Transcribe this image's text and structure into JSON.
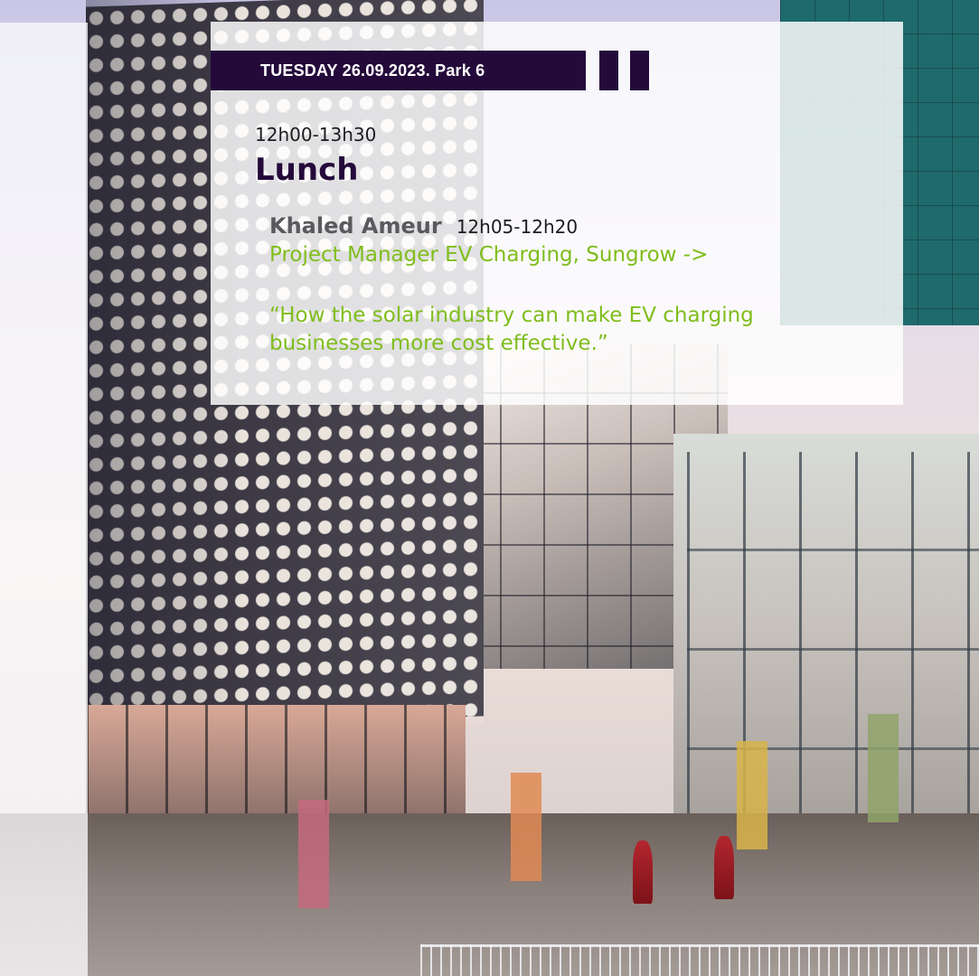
{
  "schedule": {
    "date_label": "TUESDAY 26.09.2023. Park 6",
    "pause_icon": "pause-icon",
    "session": {
      "time": "12h00-13h30",
      "title": "Lunch"
    },
    "talk": {
      "speaker_name": "Khaled Ameur",
      "time": "12h05-12h20",
      "role_link": "Project Manager EV Charging, Sungrow ->",
      "quote_line1": "“How the solar industry can make EV charging",
      "quote_line2": "businesses more cost effective.”"
    }
  },
  "colors": {
    "brand_dark": "#240a3a",
    "accent_green": "#7fbd1c",
    "speaker_gray": "#5a5a5e"
  }
}
